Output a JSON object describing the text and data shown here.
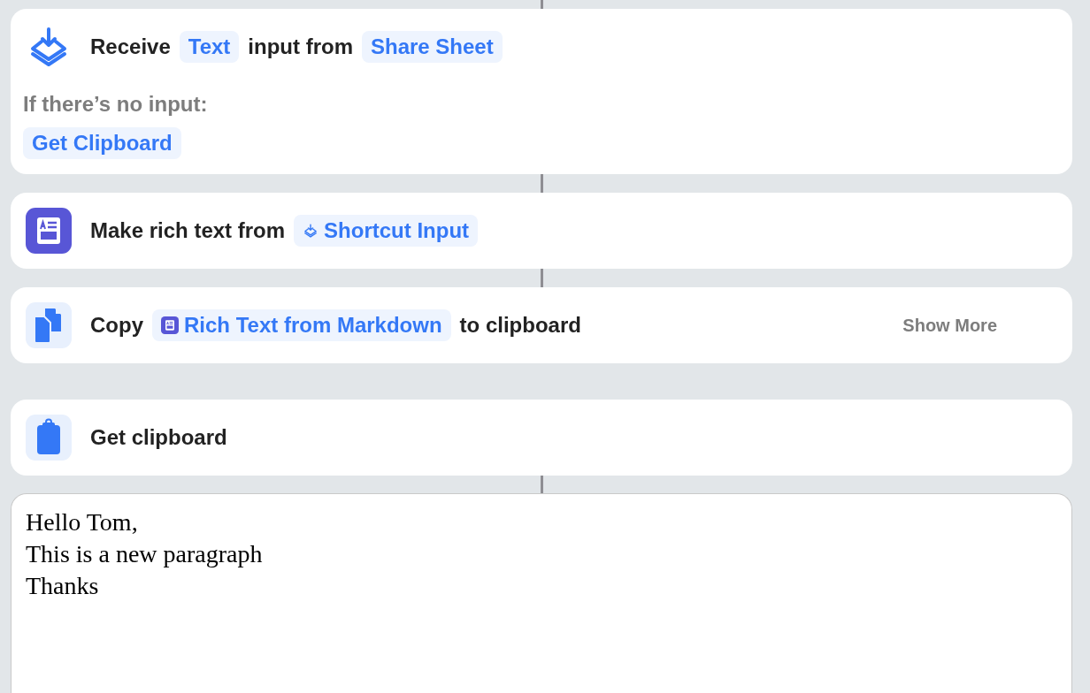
{
  "actions": [
    {
      "kind": "receive",
      "linked_above": true,
      "parts": [
        {
          "kind": "text",
          "text": "Receive"
        },
        {
          "kind": "token",
          "text": "Text"
        },
        {
          "kind": "text",
          "text": "input from"
        },
        {
          "kind": "token",
          "text": "Share Sheet"
        }
      ],
      "fallback": {
        "label": "If there’s no input:",
        "token": "Get Clipboard"
      }
    },
    {
      "kind": "richtext",
      "linked_above": true,
      "parts": [
        {
          "kind": "text",
          "text": "Make rich text from"
        },
        {
          "kind": "receive-token",
          "text": "Shortcut Input"
        }
      ]
    },
    {
      "kind": "copy",
      "linked_above": true,
      "parts": [
        {
          "kind": "text",
          "text": "Copy"
        },
        {
          "kind": "richtext-token",
          "text": "Rich Text from Markdown"
        },
        {
          "kind": "text",
          "text": "to clipboard"
        }
      ],
      "show_more": "Show More"
    },
    {
      "kind": "clipboard",
      "linked_above": false,
      "parts": [
        {
          "kind": "text",
          "text": "Get clipboard"
        }
      ]
    }
  ],
  "output": {
    "linked_above": true,
    "lines": [
      "Hello Tom,",
      "This is a new paragraph",
      "Thanks"
    ]
  }
}
